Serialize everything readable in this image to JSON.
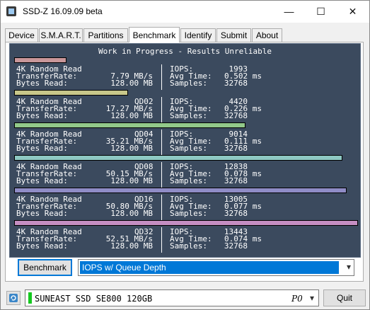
{
  "window": {
    "title": "SSD-Z 16.09.09 beta"
  },
  "controls": {
    "minimize": "—",
    "maximize": "☐",
    "close": "✕"
  },
  "tabs": [
    "Device",
    "S.M.A.R.T.",
    "Partitions",
    "Benchmark",
    "Identify",
    "Submit",
    "About"
  ],
  "benchmark": {
    "title": "Work in Progress - Results Unreliable",
    "results": [
      {
        "test": "4K Random Read",
        "qd": "",
        "transfer_label": "TransferRate:",
        "transfer_rate": "7.79 MB/s",
        "bytes_label": "Bytes Read:",
        "bytes_read": "128.00 MB",
        "iops_label": "IOPS:",
        "iops": "1993",
        "avg_label": "Avg Time:",
        "avg_time": "0.502 ms",
        "samples_label": "Samples:",
        "samples": "32768",
        "bar_color": "#c9979a",
        "bar_fraction": 0.148
      },
      {
        "test": "4K Random Read",
        "qd": "QD02",
        "transfer_label": "TransferRate:",
        "transfer_rate": "17.27 MB/s",
        "bytes_label": "Bytes Read:",
        "bytes_read": "128.00 MB",
        "iops_label": "IOPS:",
        "iops": "4420",
        "avg_label": "Avg Time:",
        "avg_time": "0.226 ms",
        "samples_label": "Samples:",
        "samples": "32768",
        "bar_color": "#c8c78a",
        "bar_fraction": 0.329
      },
      {
        "test": "4K Random Read",
        "qd": "QD04",
        "transfer_label": "TransferRate:",
        "transfer_rate": "35.21 MB/s",
        "bytes_label": "Bytes Read:",
        "bytes_read": "128.00 MB",
        "iops_label": "IOPS:",
        "iops": "9014",
        "avg_label": "Avg Time:",
        "avg_time": "0.111 ms",
        "samples_label": "Samples:",
        "samples": "32768",
        "bar_color": "#92c98a",
        "bar_fraction": 0.671
      },
      {
        "test": "4K Random Read",
        "qd": "QD08",
        "transfer_label": "TransferRate:",
        "transfer_rate": "50.15 MB/s",
        "bytes_label": "Bytes Read:",
        "bytes_read": "128.00 MB",
        "iops_label": "IOPS:",
        "iops": "12838",
        "avg_label": "Avg Time:",
        "avg_time": "0.078 ms",
        "samples_label": "Samples:",
        "samples": "32768",
        "bar_color": "#8ec9c3",
        "bar_fraction": 0.955
      },
      {
        "test": "4K Random Read",
        "qd": "QD16",
        "transfer_label": "TransferRate:",
        "transfer_rate": "50.80 MB/s",
        "bytes_label": "Bytes Read:",
        "bytes_read": "128.00 MB",
        "iops_label": "IOPS:",
        "iops": "13005",
        "avg_label": "Avg Time:",
        "avg_time": "0.077 ms",
        "samples_label": "Samples:",
        "samples": "32768",
        "bar_color": "#8f8cc6",
        "bar_fraction": 0.967
      },
      {
        "test": "4K Random Read",
        "qd": "QD32",
        "transfer_label": "TransferRate:",
        "transfer_rate": "52.51 MB/s",
        "bytes_label": "Bytes Read:",
        "bytes_read": "128.00 MB",
        "iops_label": "IOPS:",
        "iops": "13443",
        "avg_label": "Avg Time:",
        "avg_time": "0.074 ms",
        "samples_label": "Samples:",
        "samples": "32768",
        "bar_color": "#c58ec2",
        "bar_fraction": 1.0
      }
    ]
  },
  "actions": {
    "benchmark_button": "Benchmark",
    "mode_selected": "IOPS w/ Queue Depth"
  },
  "drive": {
    "name": "SUNEAST SSD SE800 120GB",
    "id": "P0",
    "status_color": "#14c81e"
  },
  "footer": {
    "quit_button": "Quit",
    "refresh_icon": "refresh-icon"
  },
  "colors": {
    "bench_bg": "#3b4a5e",
    "accent": "#0078d7"
  }
}
